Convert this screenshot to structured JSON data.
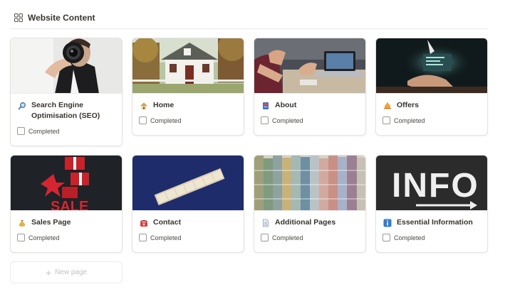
{
  "database": {
    "title": "Website Content",
    "icon": "gallery-grid-icon"
  },
  "cards": [
    {
      "id": "seo",
      "title": "Search Engine Optimisation (SEO)",
      "emoji": "magnifier-icon",
      "cover": "man-with-camera-lens",
      "property": "Completed",
      "checked": false
    },
    {
      "id": "home",
      "title": "Home",
      "emoji": "house-icon",
      "cover": "white-house-garden",
      "property": "Completed",
      "checked": false
    },
    {
      "id": "about",
      "title": "About",
      "emoji": "book-icon",
      "cover": "team-meeting-laptop",
      "property": "Completed",
      "checked": false
    },
    {
      "id": "offers",
      "title": "Offers",
      "emoji": "bell-icon",
      "cover": "hand-glowing-device",
      "property": "Completed",
      "checked": false
    },
    {
      "id": "sales",
      "title": "Sales Page",
      "emoji": "money-bag-icon",
      "cover": "sale-gift-boxes",
      "property": "Completed",
      "checked": false
    },
    {
      "id": "contact",
      "title": "Contact",
      "emoji": "telephone-icon",
      "cover": "contact-letter-tiles",
      "property": "Completed",
      "checked": false
    },
    {
      "id": "additional",
      "title": "Additional Pages",
      "emoji": "page-icon",
      "cover": "paint-swatches",
      "property": "Completed",
      "checked": false
    },
    {
      "id": "essential",
      "title": "Essential Information",
      "emoji": "info-icon",
      "cover": "info-chalkboard",
      "property": "Completed",
      "checked": false
    }
  ],
  "new_page": {
    "label": "New page",
    "icon": "plus-icon"
  }
}
